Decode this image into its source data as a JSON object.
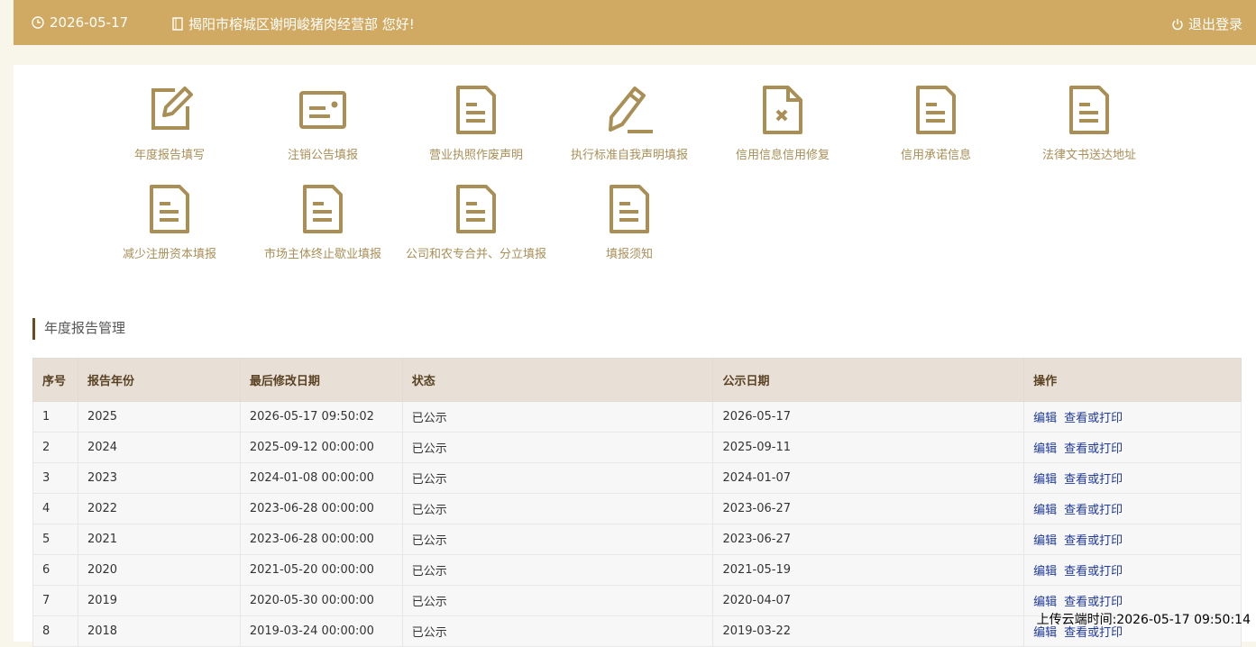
{
  "topbar": {
    "date": "2026-05-17",
    "greeting": "揭阳市榕城区谢明峻猪肉经营部 您好!",
    "logout": "退出登录"
  },
  "tiles": [
    {
      "label": "年度报告填写",
      "icon": "edit-icon"
    },
    {
      "label": "注销公告填报",
      "icon": "card-icon"
    },
    {
      "label": "营业执照作废声明",
      "icon": "document-icon"
    },
    {
      "label": "执行标准自我声明填报",
      "icon": "pencil-icon"
    },
    {
      "label": "信用信息信用修复",
      "icon": "document-x-icon"
    },
    {
      "label": "信用承诺信息",
      "icon": "document-icon"
    },
    {
      "label": "法律文书送达地址",
      "icon": "document-icon"
    },
    {
      "label": "减少注册资本填报",
      "icon": "document-icon"
    },
    {
      "label": "市场主体终止歇业填报",
      "icon": "document-icon"
    },
    {
      "label": "公司和农专合并、分立填报",
      "icon": "document-icon"
    },
    {
      "label": "填报须知",
      "icon": "document-icon"
    }
  ],
  "section": {
    "title": "年度报告管理"
  },
  "table": {
    "headers": [
      "序号",
      "报告年份",
      "最后修改日期",
      "状态",
      "公示日期",
      "操作"
    ],
    "edit_label": "编辑",
    "view_label": "查看或打印",
    "rows": [
      [
        "1",
        "2025",
        "2026-05-17 09:50:02",
        "已公示",
        "2026-05-17"
      ],
      [
        "2",
        "2024",
        "2025-09-12 00:00:00",
        "已公示",
        "2025-09-11"
      ],
      [
        "3",
        "2023",
        "2024-01-08 00:00:00",
        "已公示",
        "2024-01-07"
      ],
      [
        "4",
        "2022",
        "2023-06-28 00:00:00",
        "已公示",
        "2023-06-27"
      ],
      [
        "5",
        "2021",
        "2023-06-28 00:00:00",
        "已公示",
        "2023-06-27"
      ],
      [
        "6",
        "2020",
        "2021-05-20 00:00:00",
        "已公示",
        "2021-05-19"
      ],
      [
        "7",
        "2019",
        "2020-05-30 00:00:00",
        "已公示",
        "2020-04-07"
      ],
      [
        "8",
        "2018",
        "2019-03-24 00:00:00",
        "已公示",
        "2019-03-22"
      ]
    ]
  },
  "upload_stamp": "上传云端时间:2026-05-17 09:50:14",
  "colors": {
    "topbar": "#d0aa62",
    "icon": "#a98e56",
    "link": "#1f3a9b",
    "accent": "#6b4a1c"
  }
}
